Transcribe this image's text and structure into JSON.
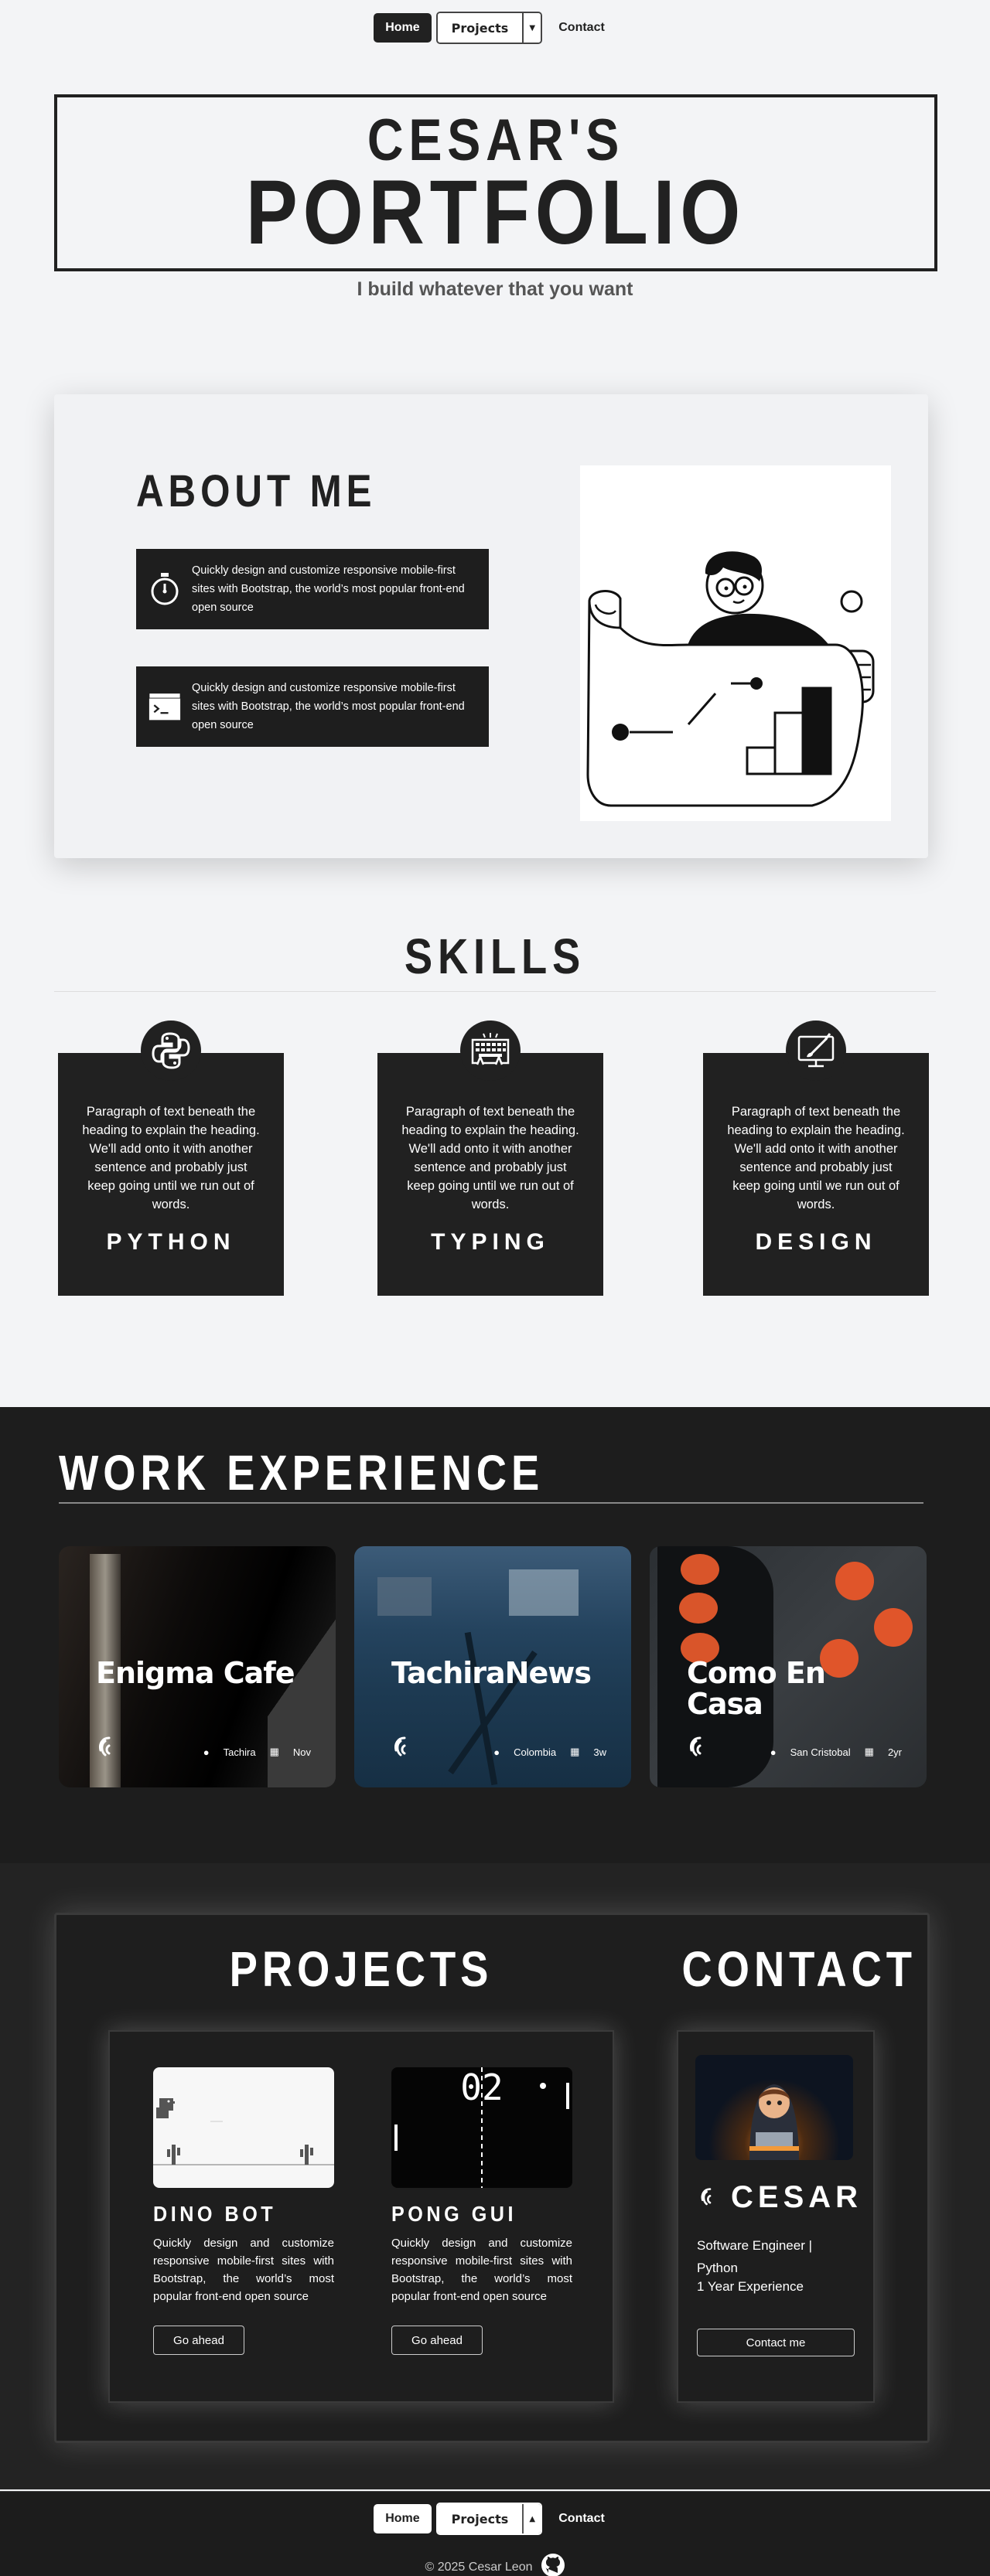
{
  "nav": {
    "home": "Home",
    "projects": "Projects",
    "contact": "Contact"
  },
  "hero": {
    "line1": "CESAR'S",
    "line2": "PORTFOLIO",
    "subtitle": "I build whatever that you want"
  },
  "about": {
    "title": "ABOUT ME",
    "cards": [
      {
        "icon": "stopwatch-icon",
        "text": "Quickly design and customize responsive mobile-first sites with Bootstrap, the world’s most popular front-end open source"
      },
      {
        "icon": "terminal-icon",
        "text": "Quickly design and customize responsive mobile-first sites with Bootstrap, the world’s most popular front-end open source"
      }
    ]
  },
  "skills": {
    "title": "SKILLS",
    "items": [
      {
        "icon": "python-icon",
        "text": "Paragraph of text beneath the heading to explain the heading. We'll add onto it with another sentence and probably just keep going until we run out of words.",
        "name": "PYTHON"
      },
      {
        "icon": "keyboard-typing-icon",
        "text": "Paragraph of text beneath the heading to explain the heading. We'll add onto it with another sentence and probably just keep going until we run out of words.",
        "name": "TYPING"
      },
      {
        "icon": "design-monitor-icon",
        "text": "Paragraph of text beneath the heading to explain the heading. We'll add onto it with another sentence and probably just keep going until we run out of words.",
        "name": "DESIGN"
      }
    ]
  },
  "work": {
    "title": "WORK EXPERIENCE",
    "cards": [
      {
        "title": "Enigma Cafe",
        "location": "Tachira",
        "date": "Nov"
      },
      {
        "title": "TachiraNews",
        "location": "Colombia",
        "date": "3w"
      },
      {
        "title": "Como En Casa",
        "location": "San Cristobal",
        "date": "2yr"
      }
    ]
  },
  "projects": {
    "title": "PROJECTS",
    "items": [
      {
        "name": "DINO BOT",
        "text": "Quickly design and customize responsive mobile-first sites with Bootstrap, the world’s most popular front-end open source",
        "button": "Go ahead"
      },
      {
        "name": "PONG GUI",
        "text": "Quickly design and customize responsive mobile-first sites with Bootstrap, the world’s most popular front-end open source",
        "button": "Go ahead"
      }
    ],
    "pong_score": "02"
  },
  "contact": {
    "title": "CONTACT",
    "name": "CESAR",
    "role": "Software Engineer | Python",
    "experience": "1 Year Experience",
    "button": "Contact me"
  },
  "footer": {
    "copyright": "© 2025 Cesar Leon"
  },
  "colors": {
    "dark": "#212121",
    "light_bg": "#f3f4f6"
  }
}
